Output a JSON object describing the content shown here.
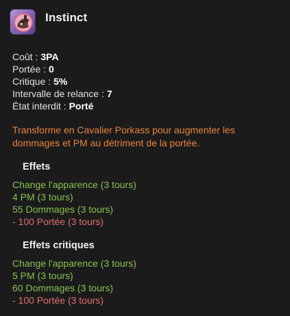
{
  "spell": {
    "title": "Instinct",
    "icon": "cavalier-porkass-icon"
  },
  "stats": [
    {
      "label": "Coût :",
      "value": "3PA"
    },
    {
      "label": "Portée :",
      "value": "0"
    },
    {
      "label": "Critique :",
      "value": "5%"
    },
    {
      "label": "Intervalle de relance :",
      "value": "7"
    },
    {
      "label": "État interdit :",
      "value": "Porté"
    }
  ],
  "description": "Transforme en Cavalier Porkass pour augmenter les dommages et PM au détriment de la portée.",
  "effects": {
    "title": "Effets",
    "lines": [
      {
        "text": "Change l'apparence (3 tours)",
        "kind": "positive"
      },
      {
        "text": "4 PM (3 tours)",
        "kind": "positive"
      },
      {
        "text": "55 Dommages (3 tours)",
        "kind": "positive"
      },
      {
        "text": "- 100 Portée (3 tours)",
        "kind": "negative"
      }
    ]
  },
  "critical_effects": {
    "title": "Effets critiques",
    "lines": [
      {
        "text": "Change l'apparence (3 tours)",
        "kind": "positive"
      },
      {
        "text": "5 PM (3 tours)",
        "kind": "positive"
      },
      {
        "text": "60 Dommages (3 tours)",
        "kind": "positive"
      },
      {
        "text": "- 100 Portée (3 tours)",
        "kind": "negative"
      }
    ]
  },
  "colors": {
    "positive": "#86c24f",
    "negative": "#e0706f",
    "description": "#e8843c"
  }
}
